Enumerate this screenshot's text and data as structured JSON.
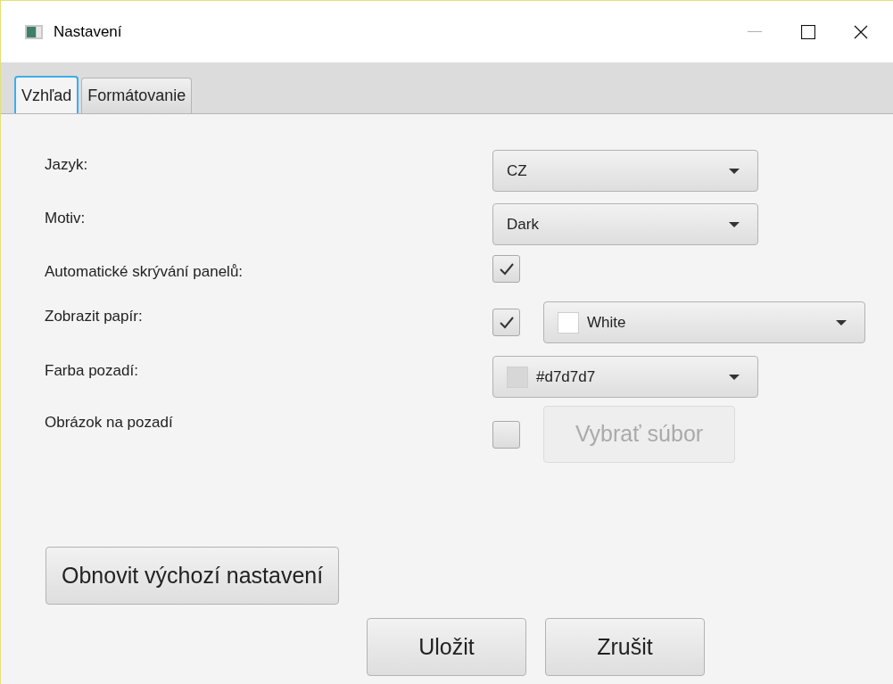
{
  "window": {
    "title": "Nastavení"
  },
  "tabs": [
    {
      "label": "Vzhľad",
      "selected": true
    },
    {
      "label": "Formátovanie",
      "selected": false
    }
  ],
  "rows": [
    {
      "kind": "select",
      "label": "Jazyk:",
      "value": "CZ"
    },
    {
      "kind": "select",
      "label": "Motiv:",
      "value": "Dark"
    },
    {
      "kind": "checkbox",
      "label": "Automatické skrývání panelů:",
      "checked": true
    },
    {
      "kind": "checkbox_color",
      "label": "Zobrazit papír:",
      "checked": true,
      "value": "White",
      "color": "#ffffff"
    },
    {
      "kind": "color",
      "label": "Farba pozadí:",
      "value": "#d7d7d7",
      "color": "#d7d7d7"
    },
    {
      "kind": "checkbox_button",
      "label": "Obrázok na pozadí",
      "checked": false,
      "button": "Vybrať súbor",
      "disabled": true
    }
  ],
  "reset_button": "Obnovit výchozí nastavení",
  "buttons": [
    "Uložit",
    "Zrušit"
  ]
}
